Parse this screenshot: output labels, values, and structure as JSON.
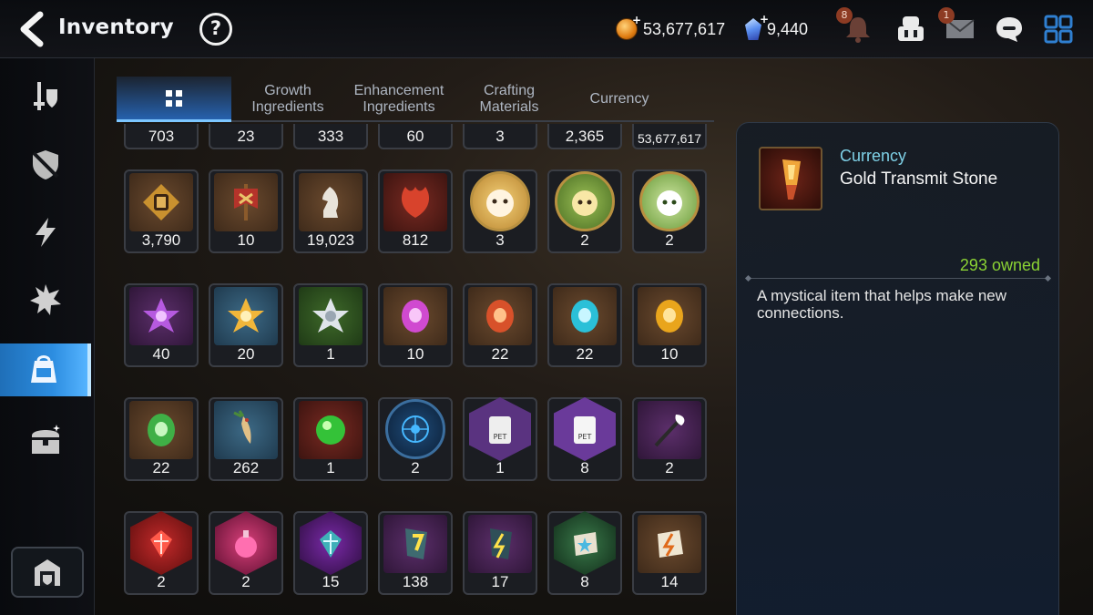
{
  "header": {
    "title": "Inventory",
    "help_label": "?",
    "gold_amount": "53,677,617",
    "crystal_amount": "9,440",
    "notification_badge": "8",
    "mail_badge": "1"
  },
  "tabs": [
    {
      "label": "",
      "active": true
    },
    {
      "label": "Growth\nIngredients"
    },
    {
      "label": "Enhancement\nIngredients"
    },
    {
      "label": "Crafting\nMaterials"
    },
    {
      "label": "Currency"
    }
  ],
  "grid": {
    "row0": [
      "703",
      "23",
      "333",
      "60",
      "3",
      "2,365",
      "53,677,617"
    ],
    "row1": [
      "3,790",
      "10",
      "19,023",
      "812",
      "3",
      "2",
      "2"
    ],
    "row2": [
      "40",
      "20",
      "1",
      "10",
      "22",
      "22",
      "10"
    ],
    "row3": [
      "22",
      "262",
      "1",
      "2",
      "1",
      "8",
      "2"
    ],
    "row4": [
      "2",
      "2",
      "15",
      "138",
      "17",
      "8",
      "14"
    ]
  },
  "detail": {
    "category": "Currency",
    "name": "Gold Transmit Stone",
    "owned": "293 owned",
    "description": "A mystical item that helps make new connections."
  },
  "colors": {
    "accent_blue": "#2c8de0",
    "owned_green": "#8bd234",
    "category_cyan": "#7ed0e6"
  }
}
